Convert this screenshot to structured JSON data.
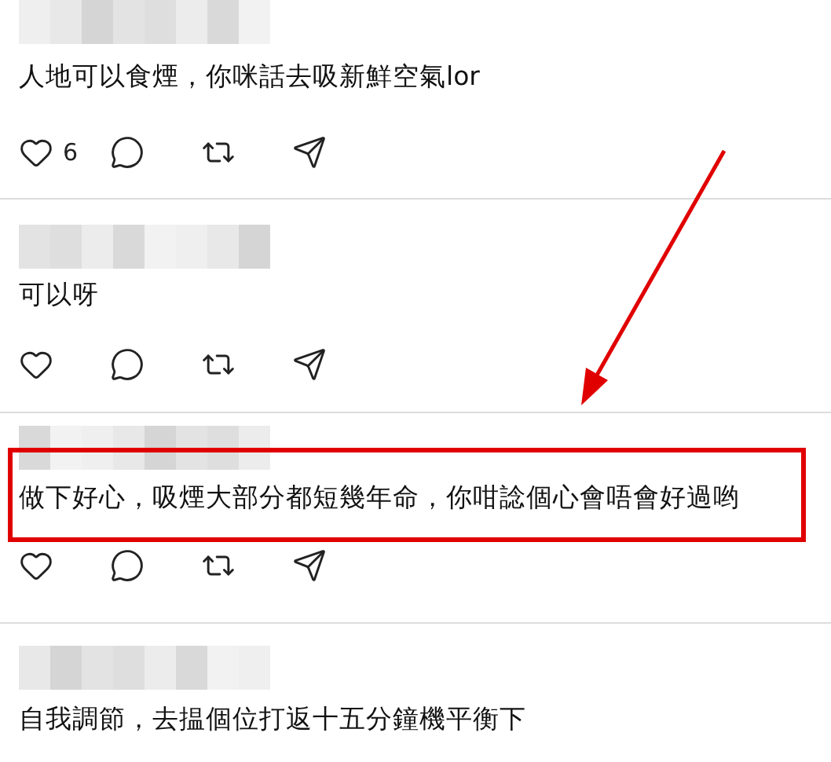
{
  "posts": [
    {
      "text": "人地可以食煙，你咪話去吸新鮮空氣lor",
      "highlighted": false,
      "actions": [
        {
          "kind": "like",
          "count": "6"
        },
        {
          "kind": "comment"
        },
        {
          "kind": "repost"
        },
        {
          "kind": "share"
        }
      ]
    },
    {
      "text": "可以呀",
      "highlighted": false,
      "actions": [
        {
          "kind": "like"
        },
        {
          "kind": "comment"
        },
        {
          "kind": "repost"
        },
        {
          "kind": "share"
        }
      ]
    },
    {
      "text": "做下好心，吸煙大部分都短幾年命，你咁諗個心會唔會好過哟",
      "highlighted": true,
      "actions": [
        {
          "kind": "like"
        },
        {
          "kind": "comment"
        },
        {
          "kind": "repost"
        },
        {
          "kind": "share"
        }
      ]
    },
    {
      "text": "自我調節，去揾個位打返十五分鐘機平衡下",
      "highlighted": false
    }
  ]
}
